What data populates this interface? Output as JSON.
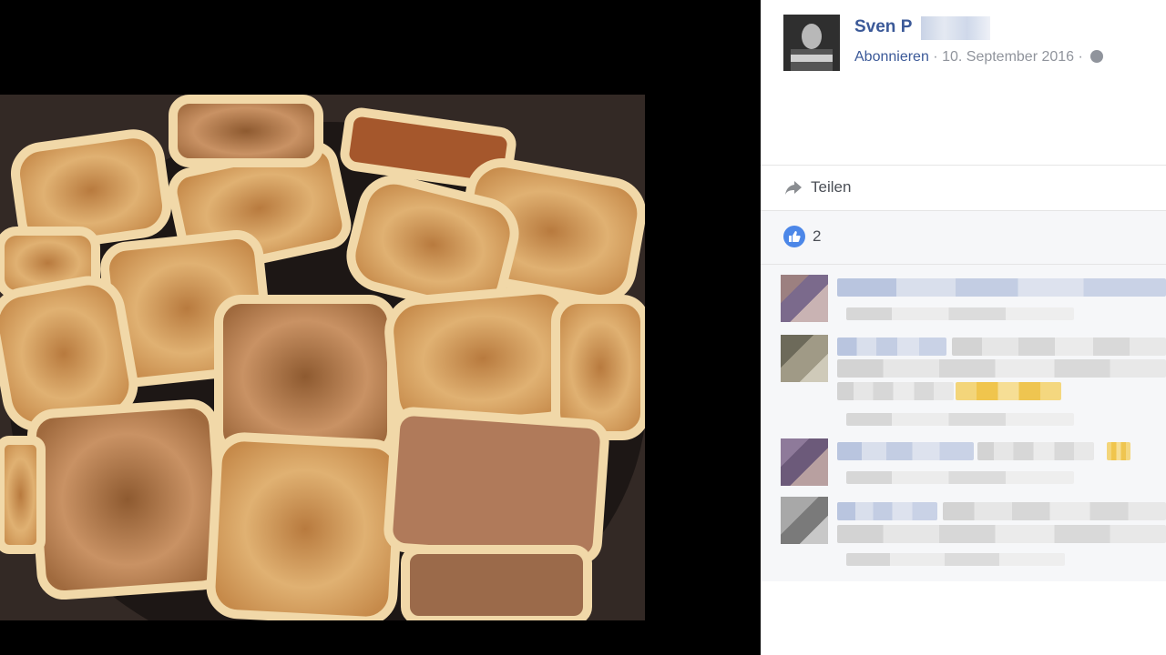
{
  "post": {
    "author_name": "Sven P",
    "follow_label": "Abonnieren",
    "separator": "·",
    "date": "10. September 2016",
    "privacy_icon": "globe-icon"
  },
  "actions": {
    "share_label": "Teilen",
    "share_icon": "share-arrow-icon"
  },
  "reactions": {
    "like_icon": "thumbs-up-icon",
    "like_count": "2"
  },
  "comments": {
    "count_visible": 4,
    "content": "blurred"
  },
  "colors": {
    "link": "#3b5998",
    "meta": "#90949c",
    "like": "#4c87e8",
    "comment_bg": "#f6f7f9"
  }
}
